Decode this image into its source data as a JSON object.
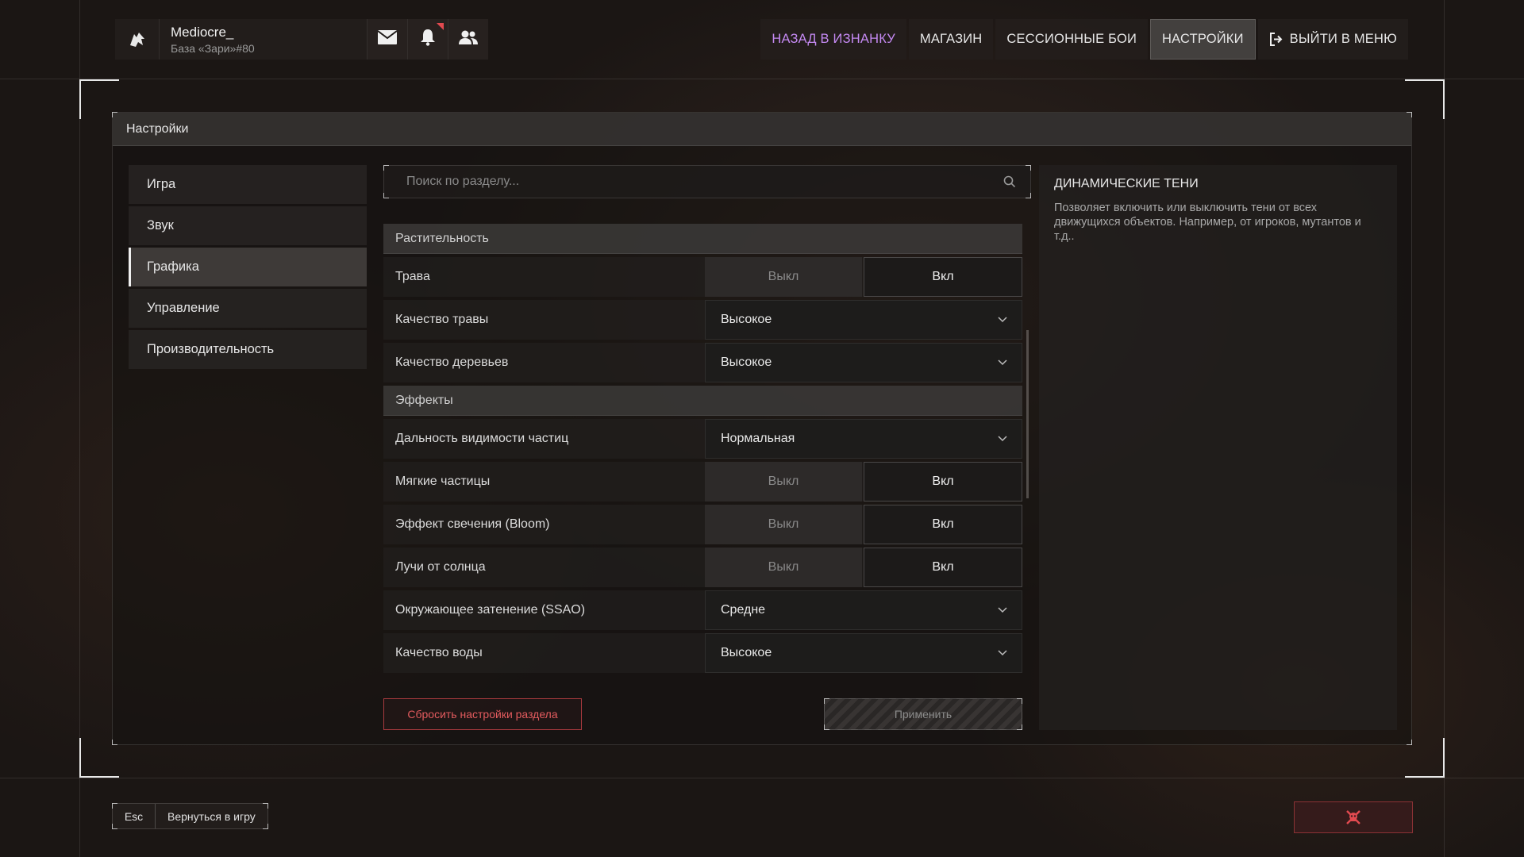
{
  "profile": {
    "name": "Mediocre_",
    "base": "База «Зари»#80",
    "icons": [
      "wolf-logo-icon",
      "mail-icon",
      "bell-icon",
      "friends-icon"
    ]
  },
  "nav": {
    "back": "НАЗАД В ИЗНАНКУ",
    "shop": "МАГАЗИН",
    "sessions": "СЕССИОННЫЕ БОИ",
    "settings": "НАСТРОЙКИ",
    "exit": "ВЫЙТИ В МЕНЮ"
  },
  "panel": {
    "title": "Настройки"
  },
  "sidebar": {
    "items": [
      {
        "label": "Игра"
      },
      {
        "label": "Звук"
      },
      {
        "label": "Графика",
        "active": true
      },
      {
        "label": "Управление"
      },
      {
        "label": "Производительность"
      }
    ]
  },
  "search": {
    "placeholder": "Поиск по разделу..."
  },
  "settings": {
    "section_vegetation": "Растительность",
    "section_effects": "Эффекты",
    "off_label": "Выкл",
    "on_label": "Вкл",
    "grass": {
      "label": "Трава",
      "value": "Вкл"
    },
    "grass_quality": {
      "label": "Качество травы",
      "value": "Высокое"
    },
    "tree_quality": {
      "label": "Качество деревьев",
      "value": "Высокое"
    },
    "particle_distance": {
      "label": "Дальность видимости частиц",
      "value": "Нормальная"
    },
    "soft_particles": {
      "label": "Мягкие частицы",
      "value": "Вкл"
    },
    "bloom": {
      "label": "Эффект свечения (Bloom)",
      "value": "Вкл"
    },
    "sun_rays": {
      "label": "Лучи от солнца",
      "value": "Вкл"
    },
    "ssao": {
      "label": "Окружающее затенение (SSAO)",
      "value": "Средне"
    },
    "water_quality": {
      "label": "Качество воды",
      "value": "Высокое"
    }
  },
  "actions": {
    "reset": "Сбросить настройки раздела",
    "apply": "Применить"
  },
  "description": {
    "title": "ДИНАМИЧЕСКИЕ ТЕНИ",
    "text": "Позволяет включить или выключить тени от всех движущихся объектов. Например, от игроков, мутантов и т.д.."
  },
  "footer": {
    "esc_key": "Esc",
    "esc_label": "Вернуться в игру"
  },
  "colors": {
    "accent_purple": "#c489f2",
    "danger_red": "#e24a50"
  }
}
